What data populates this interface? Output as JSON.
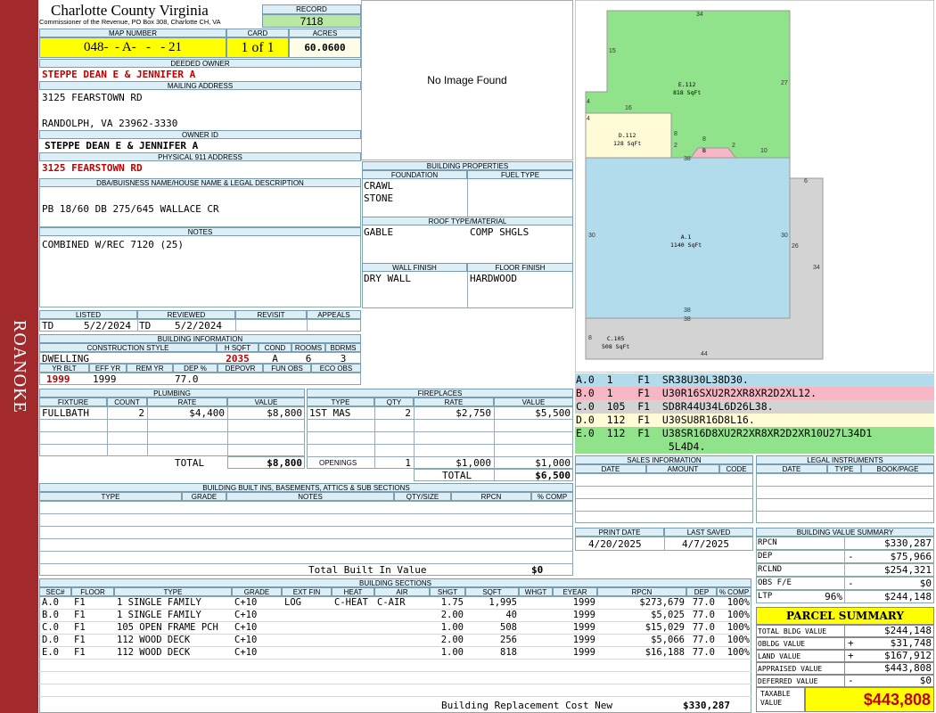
{
  "side_label": "ROANOKE",
  "county": {
    "name": "Charlotte County Virginia",
    "subtitle": "Commissioner of the Revenue, PO Box 308, Charlotte CH, VA"
  },
  "record": {
    "label": "RECORD",
    "value": "7118"
  },
  "map": {
    "label": "MAP NUMBER",
    "value": "048-  - A-   -   - 21"
  },
  "card": {
    "label": "CARD",
    "value": "1 of 1"
  },
  "acres": {
    "label": "ACRES",
    "value": "60.0600"
  },
  "deeded_owner": {
    "label": "DEEDED OWNER",
    "value": "STEPPE DEAN E & JENNIFER A"
  },
  "mailing": {
    "label": "MAILING ADDRESS",
    "line1": "3125 FEARSTOWN RD",
    "line2": "RANDOLPH, VA 23962-3330"
  },
  "owner_id": {
    "label": "OWNER ID",
    "value": "STEPPE DEAN E & JENNIFER A"
  },
  "physical": {
    "label": "PHYSICAL 911 ADDRESS",
    "value": "3125 FEARSTOWN RD"
  },
  "dba": {
    "label": "DBA/BUISNESS NAME/HOUSE NAME & LEGAL DESCRIPTION",
    "value": "PB 18/60 DB 275/645 WALLACE CR"
  },
  "notes": {
    "label": "NOTES",
    "value": "COMBINED W/REC 7120 (25)"
  },
  "photo": {
    "text": "No Image Found"
  },
  "bldg_props": {
    "label": "BUILDING PROPERTIES",
    "foundation_label": "FOUNDATION",
    "fuel_label": "FUEL TYPE",
    "foundation1": "CRAWL",
    "foundation2": "STONE",
    "roof_label": "ROOF TYPE/MATERIAL",
    "roof_type": "GABLE",
    "roof_mat": "COMP SHGLS",
    "wall_label": "WALL FINISH",
    "floor_label": "FLOOR FINISH",
    "wall": "DRY WALL",
    "floor": "HARDWOOD"
  },
  "listed": {
    "label": "LISTED",
    "by": "TD",
    "date": "5/2/2024"
  },
  "reviewed": {
    "label": "REVIEWED",
    "by": "TD",
    "date": "5/2/2024"
  },
  "revisit": {
    "label": "REVISIT"
  },
  "appeals": {
    "label": "APPEALS"
  },
  "bldg_info": {
    "label": "BUILDING INFORMATION",
    "style_label": "CONSTRUCTION STYLE",
    "hsqft_label": "H SQFT",
    "cond_label": "COND",
    "rooms_label": "ROOMS",
    "bdrms_label": "BDRMS",
    "style": "DWELLING",
    "hsqft": "2035",
    "cond": "A",
    "rooms": "6",
    "bdrms": "3",
    "yrblt_label": "YR BLT",
    "effyr_label": "EFF YR",
    "remyr_label": "REM YR",
    "dep_label": "DEP %",
    "depovr_label": "DEPOVR",
    "funobs_label": "FUN OBS",
    "ecoobs_label": "ECO OBS",
    "yrblt": "1999",
    "effyr": "1999",
    "dep": "77.0"
  },
  "plumbing": {
    "label": "PLUMBING",
    "cols": [
      "FIXTURE",
      "COUNT",
      "RATE",
      "VALUE"
    ],
    "row": [
      "FULLBATH",
      "2",
      "$4,400",
      "$8,800"
    ],
    "total_label": "TOTAL",
    "total": "$8,800"
  },
  "fireplaces": {
    "label": "FIREPLACES",
    "cols": [
      "TYPE",
      "QTY",
      "RATE",
      "VALUE"
    ],
    "row": [
      "1ST MAS",
      "2",
      "$2,750",
      "$5,500"
    ],
    "openings_label": "OPENINGS",
    "openings": [
      "1",
      "$1,000",
      "$1,000"
    ],
    "total_label": "TOTAL",
    "total": "$6,500"
  },
  "builtins": {
    "label": "BUILDING BUILT INS, BASEMENTS, ATTICS & SUB SECTIONS",
    "cols": [
      "TYPE",
      "GRADE",
      "NOTES",
      "QTY/SIZE",
      "RPCN",
      "% COMP"
    ],
    "total_label": "Total Built In Value",
    "total": "$0"
  },
  "sections": {
    "label": "BUILDING SECTIONS",
    "cols": [
      "SEC#",
      "FLOOR",
      "TYPE",
      "GRADE",
      "EXT FIN",
      "HEAT",
      "AIR",
      "SHGT",
      "SQFT",
      "WHGT",
      "EYEAR",
      "RPCN",
      "DEP",
      "% COMP"
    ],
    "rows": [
      [
        "A.0",
        "F1",
        "1 SINGLE FAMILY",
        "C+10",
        "LOG",
        "C-HEAT",
        "C-AIR",
        "1.75",
        "1,995",
        "",
        "1999",
        "$273,679",
        "77.0",
        "100%"
      ],
      [
        "B.0",
        "F1",
        "1 SINGLE FAMILY",
        "C+10",
        "",
        "",
        "",
        "2.00",
        "40",
        "",
        "1999",
        "$5,025",
        "77.0",
        "100%"
      ],
      [
        "C.0",
        "F1",
        "105 OPEN FRAME PCH",
        "C+10",
        "",
        "",
        "",
        "1.00",
        "508",
        "",
        "1999",
        "$15,029",
        "77.0",
        "100%"
      ],
      [
        "D.0",
        "F1",
        "112 WOOD DECK",
        "C+10",
        "",
        "",
        "",
        "2.00",
        "256",
        "",
        "1999",
        "$5,066",
        "77.0",
        "100%"
      ],
      [
        "E.0",
        "F1",
        "112 WOOD DECK",
        "C+10",
        "",
        "",
        "",
        "1.00",
        "818",
        "",
        "1999",
        "$16,188",
        "77.0",
        "100%"
      ]
    ],
    "total_label": "Building Replacement Cost New",
    "total": "$330,287"
  },
  "sketch": {
    "labels": [
      {
        "id": "E.112",
        "sub": "818 SqFt"
      },
      {
        "id": "D.112",
        "sub": "128 SqFt"
      },
      {
        "id": "A.1",
        "sub": "1140 SqFt"
      },
      {
        "id": "C.105",
        "sub": "508 SqFt"
      },
      {
        "id": "B",
        "sub": ""
      }
    ],
    "dims": [
      "34",
      "15",
      "27",
      "4",
      "16",
      "4",
      "8",
      "2",
      "8",
      "2",
      "38",
      "10",
      "6",
      "30",
      "30",
      "26",
      "34",
      "38",
      "38",
      "8",
      "44"
    ],
    "colors": {
      "green": "#90e38a",
      "yellow": "#fffbd6",
      "pink": "#f7b6c4",
      "blue": "#b2dcec",
      "gray": "#d3d3d3"
    }
  },
  "vectors": [
    {
      "text": "A.0  1    F1  SR38U30L38D30.",
      "color": "#b2dcec"
    },
    {
      "text": "B.0  1    F1  U30R16SXU2R2XR8XR2D2XL12.",
      "color": "#f7b6c4"
    },
    {
      "text": "C.0  105  F1  SD8R44U34L6D26L38.",
      "color": "#d3d3d3"
    },
    {
      "text": "D.0  112  F1  U30SU8R16D8L16.",
      "color": "#fffbd6"
    },
    {
      "text": "E.0  112  F1  U38SR16D8XU2R2XR8XR2D2XR10U27L34D1",
      "color": "#90e38a"
    },
    {
      "text": "               5L4D4.",
      "color": "#90e38a"
    }
  ],
  "sales": {
    "label": "SALES INFORMATION",
    "cols": [
      "DATE",
      "AMOUNT",
      "CODE"
    ]
  },
  "legal": {
    "label": "LEGAL INSTRUMENTS",
    "cols": [
      "DATE",
      "TYPE",
      "BOOK/PAGE"
    ]
  },
  "print_date": {
    "label": "PRINT DATE",
    "value": "4/20/2025"
  },
  "last_saved": {
    "label": "LAST SAVED",
    "value": "4/7/2025"
  },
  "bvs": {
    "label": "BUILDING VALUE SUMMARY",
    "rows": [
      [
        "RPCN",
        "",
        "$330,287"
      ],
      [
        "DEP",
        "-",
        "$75,966"
      ],
      [
        "RCLND",
        "",
        "$254,321"
      ],
      [
        "OBS F/E",
        "-",
        "$0"
      ],
      [
        "LTP",
        "96%",
        "$244,148"
      ]
    ]
  },
  "parcel": {
    "label": "PARCEL SUMMARY",
    "rows": [
      [
        "TOTAL BLDG VALUE",
        "",
        "$244,148"
      ],
      [
        "OBLDG VALUE",
        "+",
        "$31,748"
      ],
      [
        "LAND VALUE",
        "+",
        "$167,912"
      ],
      [
        "APPRAISED VALUE",
        "",
        "$443,808"
      ],
      [
        "DEFERRED VALUE",
        "-",
        "$0"
      ]
    ],
    "taxable_label1": "TAXABLE",
    "taxable_label2": "VALUE",
    "taxable": "$443,808"
  }
}
